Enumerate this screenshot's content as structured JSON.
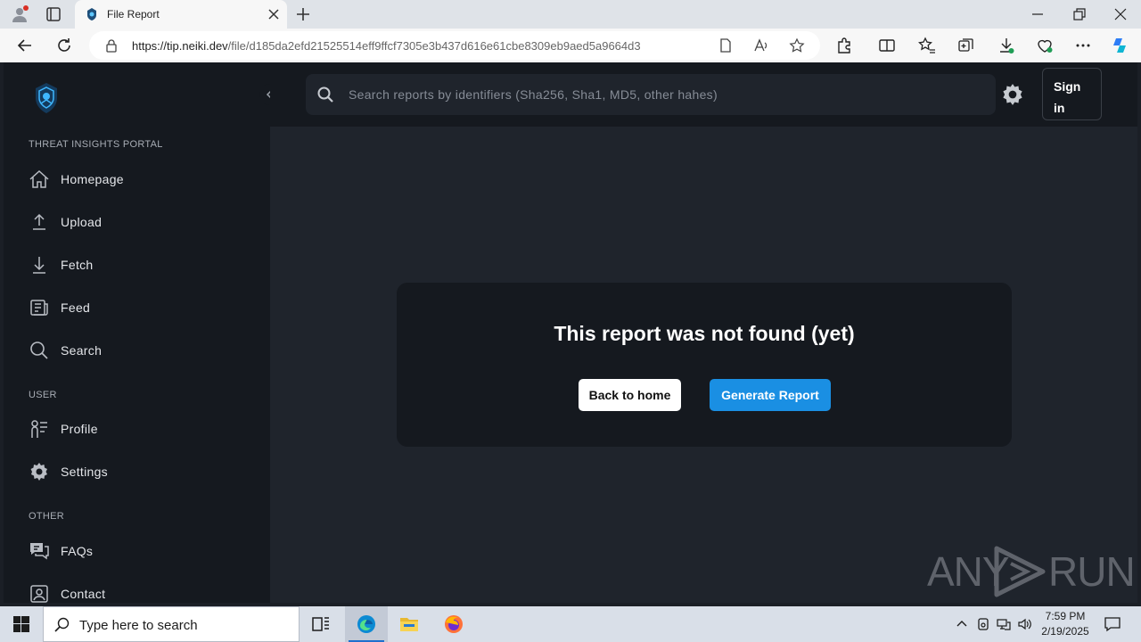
{
  "browser": {
    "tab_title": "File Report",
    "url_host": "https://tip.neiki.dev",
    "url_path": "/file/d185da2efd21525514eff9ffcf7305e3b437d616e61cbe8309eb9aed5a9664d3"
  },
  "sidebar": {
    "sections": [
      {
        "title": "THREAT INSIGHTS PORTAL"
      },
      {
        "title": "USER"
      },
      {
        "title": "OTHER"
      }
    ],
    "items": [
      {
        "label": "Homepage",
        "icon": "home-icon"
      },
      {
        "label": "Upload",
        "icon": "upload-icon"
      },
      {
        "label": "Fetch",
        "icon": "fetch-icon"
      },
      {
        "label": "Feed",
        "icon": "feed-icon"
      },
      {
        "label": "Search",
        "icon": "search-icon"
      },
      {
        "label": "Profile",
        "icon": "profile-icon"
      },
      {
        "label": "Settings",
        "icon": "gear-icon"
      },
      {
        "label": "FAQs",
        "icon": "faq-icon"
      },
      {
        "label": "Contact",
        "icon": "contact-icon"
      }
    ]
  },
  "header": {
    "search_placeholder": "Search reports by identifiers (Sha256, Sha1, MD5, other hahes)",
    "signin_label": "Sign in"
  },
  "main": {
    "message": "This report was not found (yet)",
    "back_label": "Back to home",
    "generate_label": "Generate Report"
  },
  "watermark": {
    "left": "ANY",
    "right": "RUN"
  },
  "taskbar": {
    "search_text": "Type here to search",
    "time": "7:59 PM",
    "date": "2/19/2025"
  },
  "colors": {
    "accent": "#1a8fe3",
    "sidebar_bg": "#15191f",
    "page_bg": "#1f242c"
  }
}
